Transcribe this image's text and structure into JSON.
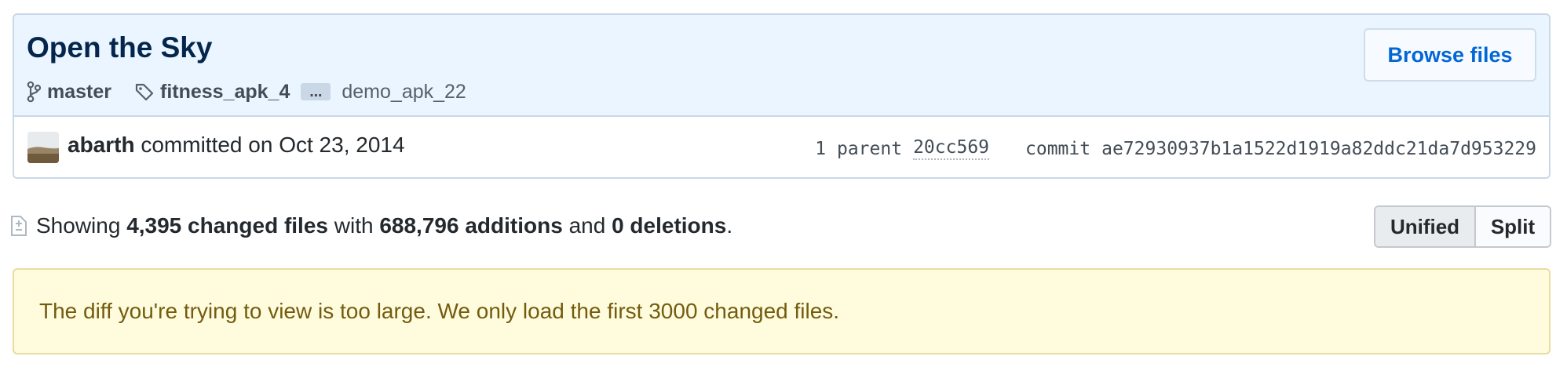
{
  "commit": {
    "title": "Open the Sky",
    "branch": "master",
    "tag": "fitness_apk_4",
    "more_label": "…",
    "other_tag": "demo_apk_22",
    "browse_label": "Browse files",
    "author": "abarth",
    "committed_text": "committed on Oct 23, 2014",
    "parent_label": "1 parent",
    "parent_sha": "20cc569",
    "commit_label": "commit",
    "commit_sha": "ae72930937b1a1522d1919a82ddc21da7d953229"
  },
  "summary": {
    "showing": "Showing",
    "files": "4,395 changed files",
    "with": "with",
    "additions": "688,796 additions",
    "and": "and",
    "deletions": "0 deletions",
    "period": "."
  },
  "view_toggle": {
    "unified_label": "Unified",
    "split_label": "Split",
    "selected": "Unified"
  },
  "warning": {
    "message": "The diff you're trying to view is too large. We only load the first 3000 changed files."
  },
  "icons": {
    "branch": "git-branch-icon",
    "tag": "tag-icon",
    "diff": "file-diff-icon"
  },
  "colors": {
    "header_bg": "#eaf5ff",
    "title": "#05264c",
    "link": "#0366d6",
    "warning_bg": "#fffbdd",
    "warning_text": "#735c0f"
  }
}
